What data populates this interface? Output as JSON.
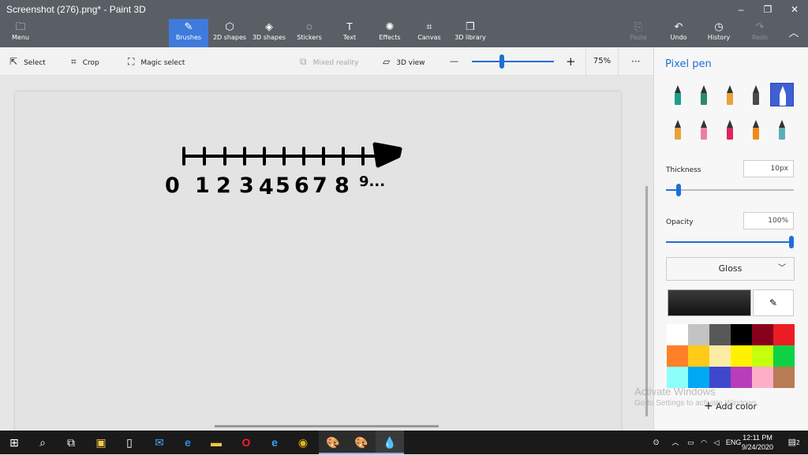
{
  "window": {
    "title": "Screenshot (276).png* - Paint 3D",
    "minimize": "–",
    "maximize": "❐",
    "close": "✕"
  },
  "ribbon": {
    "menu": "Menu",
    "tools": [
      {
        "id": "brushes",
        "label": "Brushes",
        "icon": "✎"
      },
      {
        "id": "shapes2d",
        "label": "2D shapes",
        "icon": "⬡"
      },
      {
        "id": "shapes3d",
        "label": "3D shapes",
        "icon": "◈"
      },
      {
        "id": "stickers",
        "label": "Stickers",
        "icon": "◌"
      },
      {
        "id": "text",
        "label": "Text",
        "icon": "T"
      },
      {
        "id": "effects",
        "label": "Effects",
        "icon": "✺"
      },
      {
        "id": "canvas",
        "label": "Canvas",
        "icon": "⌗"
      },
      {
        "id": "library",
        "label": "3D library",
        "icon": "❒"
      }
    ],
    "paste": "Paste",
    "undo": "Undo",
    "history": "History",
    "redo": "Redo"
  },
  "toolbar": {
    "select": "Select",
    "crop": "Crop",
    "magic_select": "Magic select",
    "mixed_reality": "Mixed reality",
    "view3d": "3D view",
    "zoom_minus": "—",
    "zoom_plus": "+",
    "zoom": "75%",
    "more": "···"
  },
  "drawing": {
    "numbers": [
      "0",
      "1",
      "2",
      "3",
      "4",
      "5",
      "6",
      "7",
      "8",
      "9..."
    ]
  },
  "panel": {
    "title": "Pixel pen",
    "thickness_label": "Thickness",
    "thickness_value": "10px",
    "thickness_level": 0.1,
    "opacity_label": "Opacity",
    "opacity_value": "100%",
    "opacity_level": 1.0,
    "finish": "Gloss",
    "add_color": "Add color",
    "brushes": [
      {
        "name": "marker-icon",
        "color": "#1aa08a"
      },
      {
        "name": "calligraphy-pen-icon",
        "color": "#2a8a6c"
      },
      {
        "name": "oil-brush-icon",
        "color": "#e8a23a"
      },
      {
        "name": "watercolor-icon",
        "color": "#4a4a4a"
      },
      {
        "name": "pixel-pen-icon",
        "color": "#ffffff"
      },
      {
        "name": "pencil-icon",
        "color": "#e8a23a"
      },
      {
        "name": "eraser-icon",
        "color": "#ef7fa0"
      },
      {
        "name": "crayon-icon",
        "color": "#e0245e"
      },
      {
        "name": "spray-can-icon",
        "color": "#f08a1c"
      },
      {
        "name": "fill-icon",
        "color": "#5aaeb8"
      }
    ],
    "palette": [
      "#ffffff",
      "#c3c3c3",
      "#585858",
      "#000000",
      "#88001b",
      "#ec1c24",
      "#ff7f27",
      "#ffca18",
      "#fdeca6",
      "#fff200",
      "#c4ff0e",
      "#0ed145",
      "#8cfffb",
      "#00a8f3",
      "#3f48cc",
      "#b83dba",
      "#ffaec8",
      "#b97a56"
    ]
  },
  "watermark": {
    "line1": "Activate Windows",
    "line2": "Go to Settings to activate Windows."
  },
  "taskbar": {
    "language": "ENG",
    "time": "12:11 PM",
    "date": "9/24/2020",
    "notifications": "2"
  }
}
